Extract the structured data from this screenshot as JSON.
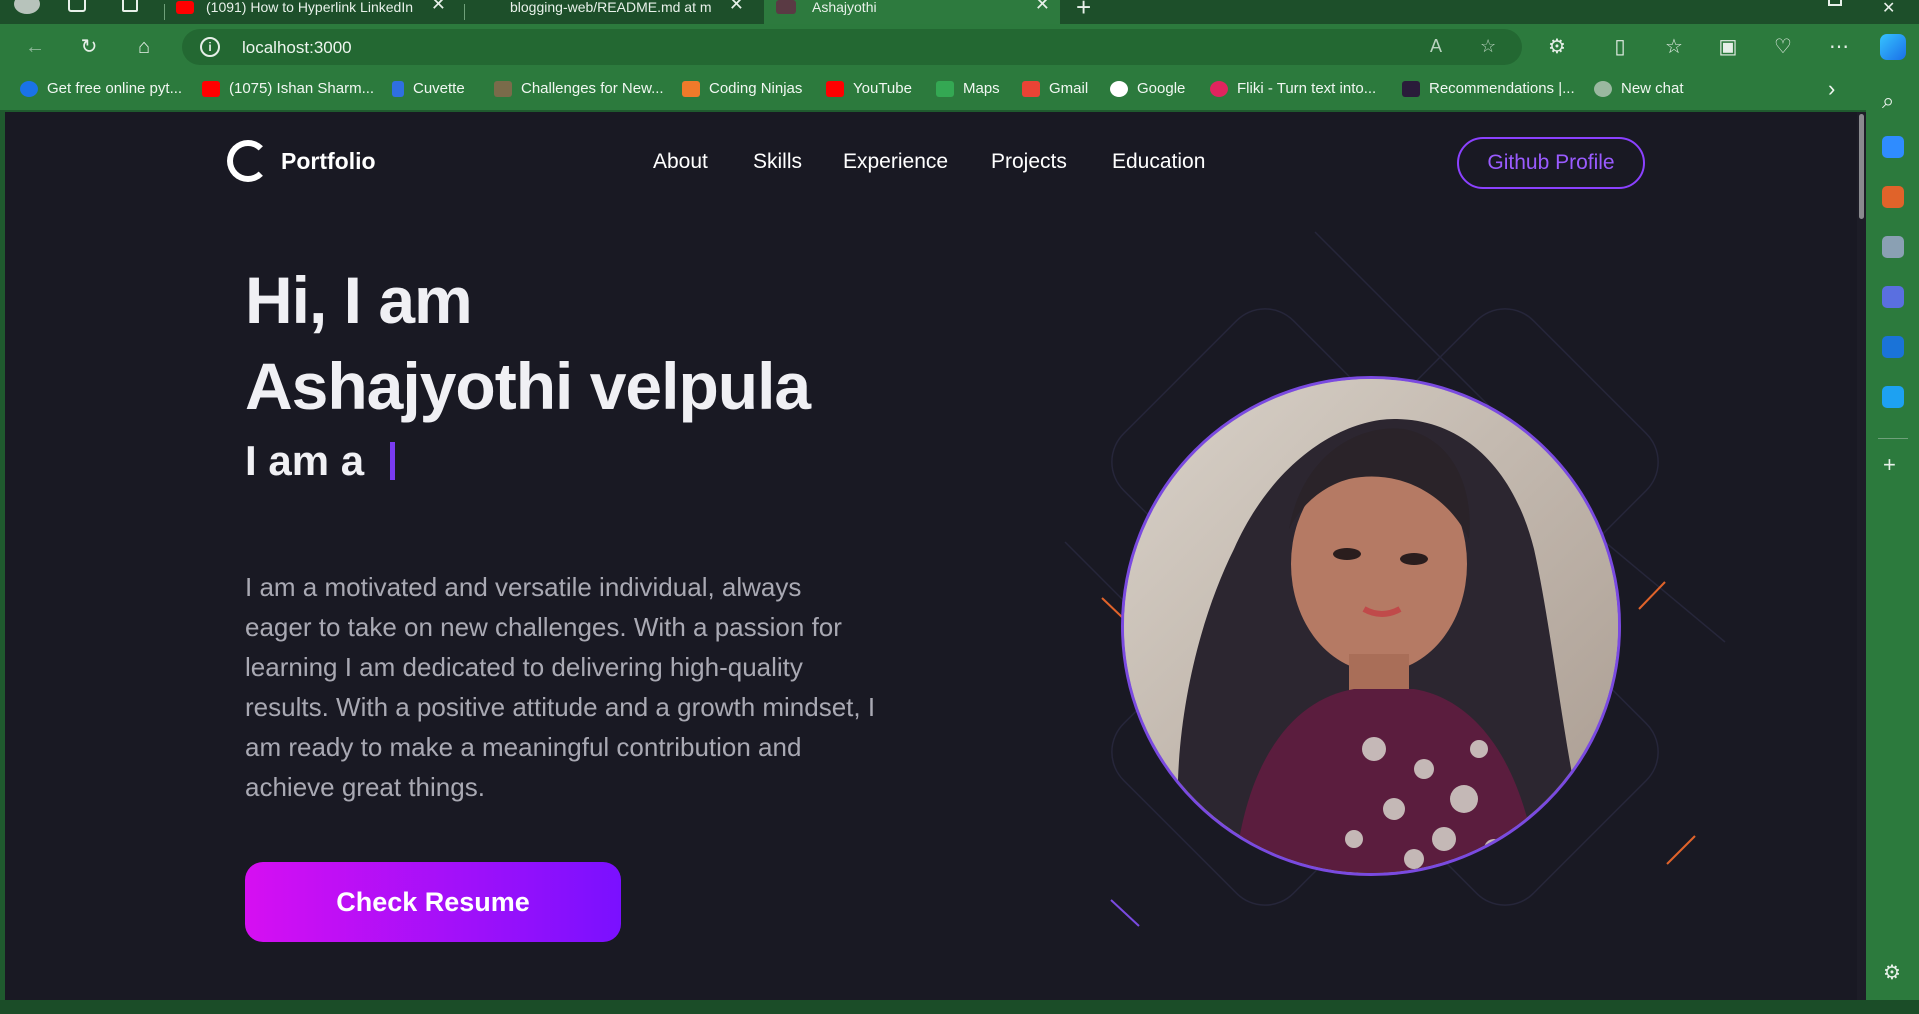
{
  "browser": {
    "tabs": [
      {
        "title": "(1091) How to Hyperlink LinkedIn",
        "icon": "youtube-icon",
        "active": false
      },
      {
        "title": "blogging-web/README.md at m",
        "icon": "github-icon",
        "active": false
      },
      {
        "title": "Ashajyothi",
        "icon": "site-icon",
        "active": true
      }
    ],
    "new_tab_label": "+",
    "address": "localhost:3000",
    "bookmarks": [
      {
        "label": "Get free online pyt...",
        "icon": "edge-icon",
        "color": "#1a73e8"
      },
      {
        "label": "(1075) Ishan Sharm...",
        "icon": "youtube-icon",
        "color": "#ff0000"
      },
      {
        "label": "Cuvette",
        "icon": "cuvette-icon",
        "color": "#2f6fe0"
      },
      {
        "label": "Challenges for New...",
        "icon": "challenges-icon",
        "color": "#7a6b4a"
      },
      {
        "label": "Coding Ninjas",
        "icon": "coding-ninjas-icon",
        "color": "#f07a2a"
      },
      {
        "label": "YouTube",
        "icon": "youtube-icon",
        "color": "#ff0000"
      },
      {
        "label": "Maps",
        "icon": "maps-icon",
        "color": "#34a853"
      },
      {
        "label": "Gmail",
        "icon": "gmail-icon",
        "color": "#ea4335"
      },
      {
        "label": "Google",
        "icon": "google-icon",
        "color": "#ffffff"
      },
      {
        "label": "Fliki - Turn text into...",
        "icon": "fliki-icon",
        "color": "#e0245e"
      },
      {
        "label": "Recommendations |...",
        "icon": "recommendations-icon",
        "color": "#2a1b3a"
      },
      {
        "label": "New chat",
        "icon": "chatgpt-icon",
        "color": "#9ab8a0"
      }
    ]
  },
  "page": {
    "logo_text": "Portfolio",
    "nav": [
      "About",
      "Skills",
      "Experience",
      "Projects",
      "Education"
    ],
    "github_button": "Github Profile",
    "heading_line1": "Hi, I am",
    "heading_line2": "Ashajyothi velpula",
    "role_prefix": "I am a",
    "bio_lines": [
      "I am a motivated and versatile individual, always",
      "eager to take on new challenges. With a passion for",
      "learning I am dedicated to delivering high-quality",
      "results. With a positive attitude and a growth mindset, I",
      "am ready to make a meaningful contribution and",
      "achieve great things."
    ],
    "resume_button": "Check Resume"
  },
  "colors": {
    "page_bg": "#191923",
    "accent": "#8b41ff",
    "button_gradient_start": "#d60ff2",
    "button_gradient_end": "#7a10ff",
    "browser_green": "#2c7a3d"
  }
}
